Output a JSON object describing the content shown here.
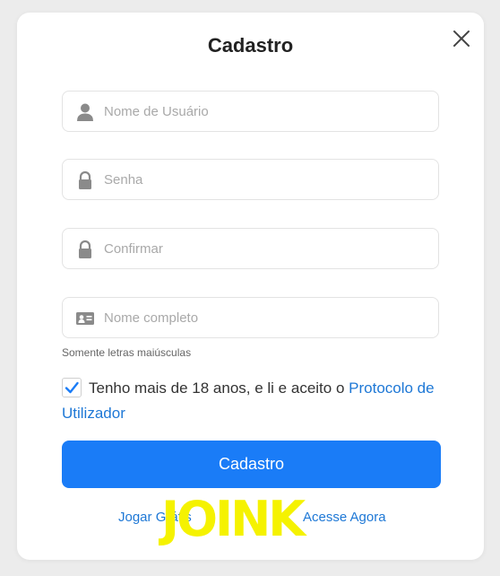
{
  "modal": {
    "title": "Cadastro",
    "close_icon": "close-icon"
  },
  "form": {
    "username": {
      "placeholder": "Nome de Usuário",
      "value": "",
      "icon": "user-icon"
    },
    "password": {
      "placeholder": "Senha",
      "value": "",
      "icon": "lock-icon"
    },
    "confirm": {
      "placeholder": "Confirmar",
      "value": "",
      "icon": "lock-icon"
    },
    "fullname": {
      "placeholder": "Nome completo",
      "value": "",
      "icon": "id-card-icon"
    },
    "fullname_hint": "Somente letras maiúsculas"
  },
  "agreement": {
    "checked": true,
    "text": "Tenho mais de 18 anos, e li e aceito o",
    "link": "Protocolo de Utilizador"
  },
  "submit_label": "Cadastro",
  "footer": {
    "play_free": "Jogar Grátis",
    "login_now": "Acesse Agora"
  },
  "watermark": "JOINK",
  "colors": {
    "accent": "#1a7cf7",
    "link": "#1e78d6",
    "watermark": "#f5f200"
  }
}
